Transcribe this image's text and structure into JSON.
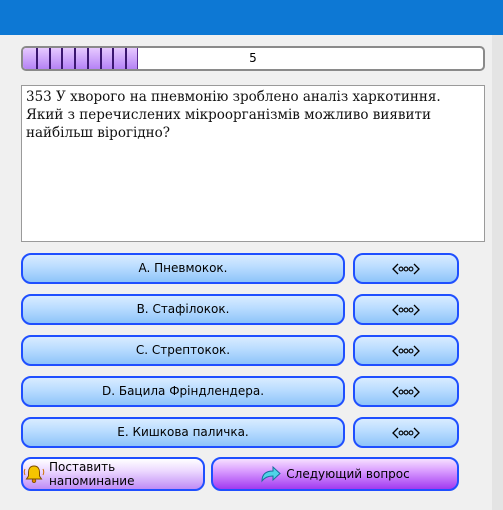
{
  "progress": {
    "value_text": "5",
    "fraction": 0.25,
    "segments": 9
  },
  "question": {
    "text": "353 У хворого на пневмонію зроблено аналіз харкотиння. Який з перечислених мікроорганізмів можливо виявити найбільш вірогідно?"
  },
  "answers": [
    {
      "label": "A. Пневмокок."
    },
    {
      "label": "B. Стафілокок."
    },
    {
      "label": "C. Стрептокок."
    },
    {
      "label": "D. Бацила Фріндлендера."
    },
    {
      "label": "E. Кишкова паличка."
    }
  ],
  "buttons": {
    "remind_label": "Поставить напоминание",
    "next_label": "Следующий вопрос"
  },
  "icons": {
    "hint": "hint-dots-icon",
    "remind": "bell-icon",
    "next": "share-arrow-icon"
  },
  "colors": {
    "titlebar": "#0d78d4",
    "button_border": "#1f4fff",
    "progress_fill": "#b582f5"
  }
}
